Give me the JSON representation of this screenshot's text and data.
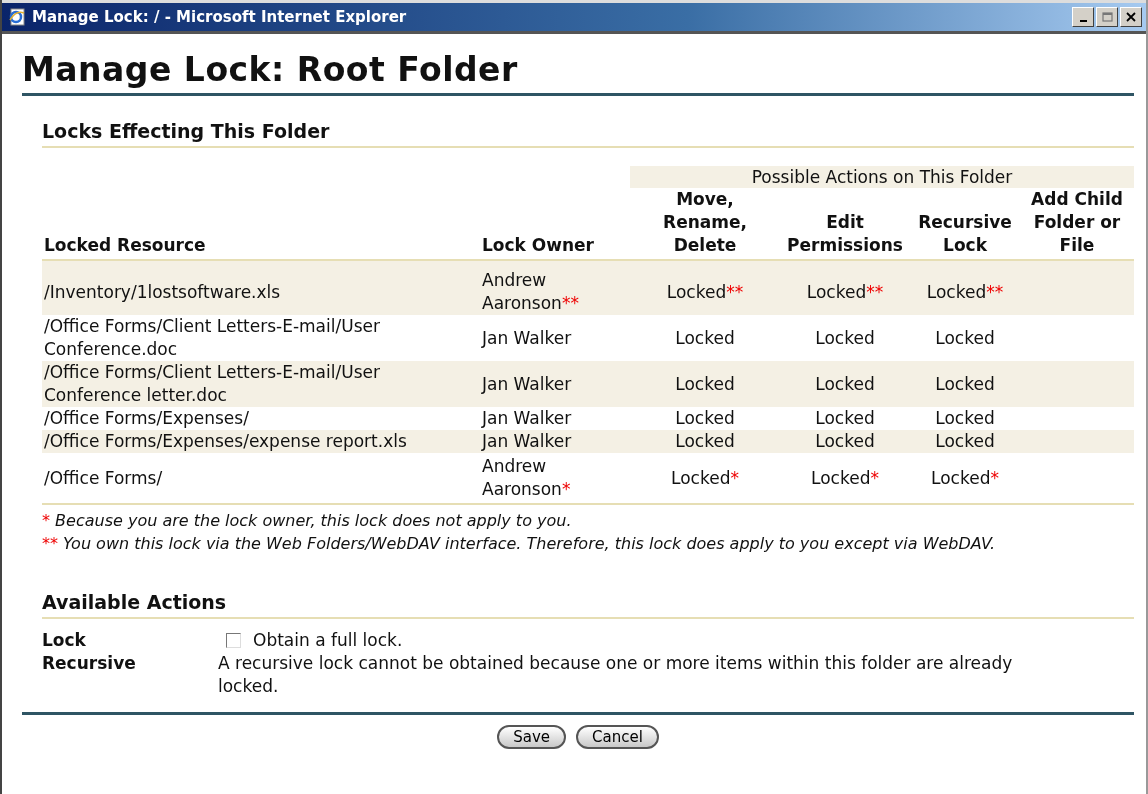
{
  "window": {
    "title": "Manage Lock: / - Microsoft Internet Explorer"
  },
  "page_title": "Manage Lock: Root Folder",
  "locks_section": {
    "heading": "Locks Effecting This Folder",
    "group_header": "Possible Actions on This Folder",
    "columns": [
      "Locked Resource",
      "Lock Owner",
      "Move, Rename, Delete",
      "Edit Permissions",
      "Recursive Lock",
      "Add Child Folder or File"
    ],
    "rows": [
      {
        "resource": "/Inventory/1lostsoftware.xls",
        "owner": {
          "text": "Andrew Aaronson",
          "mark": "**"
        },
        "actions": [
          {
            "text": "Locked",
            "mark": "**"
          },
          {
            "text": "Locked",
            "mark": "**"
          },
          {
            "text": "Locked",
            "mark": "**"
          }
        ]
      },
      {
        "resource": "/Office Forms/Client Letters-E-mail/User Conference.doc",
        "owner": {
          "text": "Jan Walker"
        },
        "actions": [
          {
            "text": "Locked"
          },
          {
            "text": "Locked"
          },
          {
            "text": "Locked"
          }
        ]
      },
      {
        "resource": "/Office Forms/Client Letters-E-mail/User Conference letter.doc",
        "owner": {
          "text": "Jan Walker"
        },
        "actions": [
          {
            "text": "Locked"
          },
          {
            "text": "Locked"
          },
          {
            "text": "Locked"
          }
        ]
      },
      {
        "resource": "/Office Forms/Expenses/",
        "owner": {
          "text": "Jan Walker"
        },
        "actions": [
          {
            "text": "Locked"
          },
          {
            "text": "Locked"
          },
          {
            "text": "Locked"
          }
        ]
      },
      {
        "resource": "/Office Forms/Expenses/expense report.xls",
        "owner": {
          "text": "Jan Walker"
        },
        "actions": [
          {
            "text": "Locked"
          },
          {
            "text": "Locked"
          },
          {
            "text": "Locked"
          }
        ]
      },
      {
        "resource": "/Office Forms/",
        "owner": {
          "text": "Andrew Aaronson",
          "mark": "*"
        },
        "actions": [
          {
            "text": "Locked",
            "mark": "*"
          },
          {
            "text": "Locked",
            "mark": "*"
          },
          {
            "text": "Locked",
            "mark": "*"
          }
        ]
      }
    ],
    "footnotes": [
      {
        "mark": "*",
        "text": "Because you are the lock owner, this lock does not apply to you."
      },
      {
        "mark": "**",
        "text": "You own this lock via the Web Folders/WebDAV interface. Therefore, this lock does apply to you except via WebDAV."
      }
    ]
  },
  "actions_section": {
    "heading": "Available Actions",
    "items": [
      {
        "kind": "checkbox",
        "label": "Lock",
        "text": "Obtain a full lock.",
        "checked": false
      },
      {
        "kind": "note",
        "label": "Recursive",
        "text": "A recursive lock cannot be obtained because one or more items within this folder are already locked."
      }
    ]
  },
  "buttons": [
    "Save",
    "Cancel"
  ]
}
